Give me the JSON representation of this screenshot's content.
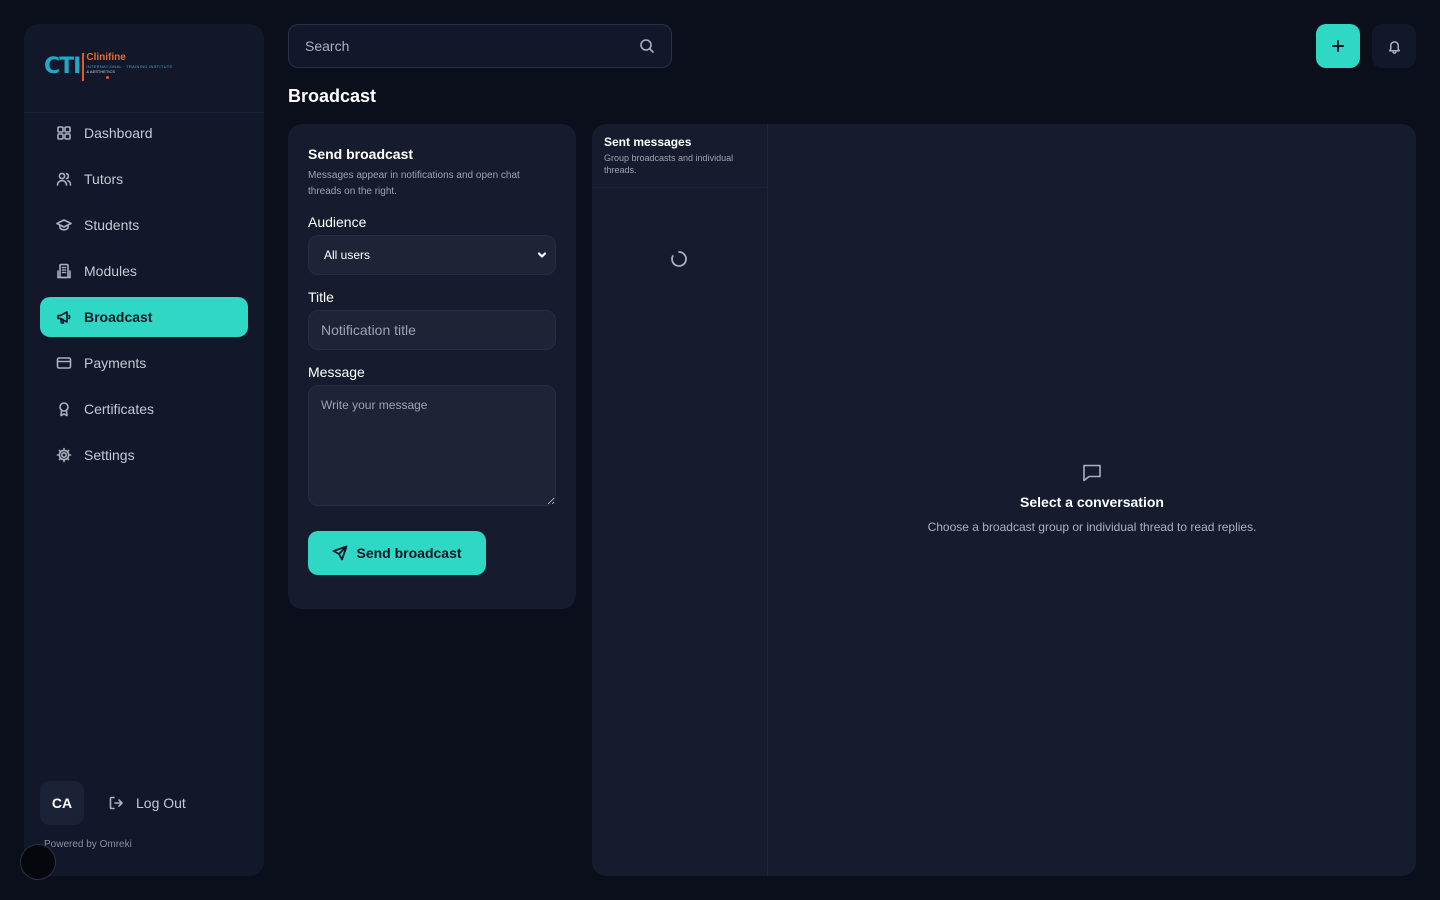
{
  "brand": {
    "logo_mark": "CTI",
    "logo_name": "Clinifine",
    "logo_sub": "INTERNATIONAL · TRAINING INSTITUTE",
    "logo_sub2": "& AESTHETICS",
    "accent_color": "#2fd8c5"
  },
  "sidebar": {
    "items": [
      {
        "label": "Dashboard",
        "icon": "grid-icon",
        "active": false
      },
      {
        "label": "Tutors",
        "icon": "users-icon",
        "active": false
      },
      {
        "label": "Students",
        "icon": "graduation-cap-icon",
        "active": false
      },
      {
        "label": "Modules",
        "icon": "building-icon",
        "active": false
      },
      {
        "label": "Broadcast",
        "icon": "megaphone-icon",
        "active": true
      },
      {
        "label": "Payments",
        "icon": "credit-card-icon",
        "active": false
      },
      {
        "label": "Certificates",
        "icon": "award-icon",
        "active": false
      },
      {
        "label": "Settings",
        "icon": "gear-icon",
        "active": false
      }
    ],
    "user_initials": "CA",
    "logout_label": "Log Out",
    "powered_by": "Powered by Omreki"
  },
  "topbar": {
    "search_placeholder": "Search"
  },
  "page": {
    "title": "Broadcast"
  },
  "send_form": {
    "title": "Send broadcast",
    "description": "Messages appear in notifications and open chat threads on the right.",
    "audience_label": "Audience",
    "audience_value": "All users",
    "title_label": "Title",
    "title_placeholder": "Notification title",
    "message_label": "Message",
    "message_placeholder": "Write your message",
    "submit_label": "Send broadcast"
  },
  "sent_messages": {
    "title": "Sent messages",
    "subtitle": "Group broadcasts and individual threads."
  },
  "conversation": {
    "empty_title": "Select a conversation",
    "empty_text": "Choose a broadcast group or individual thread to read replies."
  }
}
